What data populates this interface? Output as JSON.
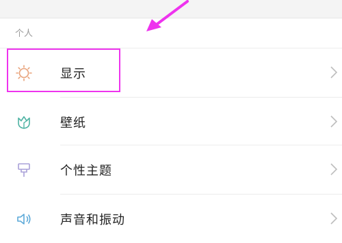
{
  "section": {
    "title": "个人"
  },
  "items": [
    {
      "label": "显示",
      "icon": "sun-icon"
    },
    {
      "label": "壁纸",
      "icon": "tulip-icon"
    },
    {
      "label": "个性主题",
      "icon": "brush-icon"
    },
    {
      "label": "声音和振动",
      "icon": "speaker-icon"
    }
  ],
  "colors": {
    "highlight": "#ee33ee",
    "arrow": "#ee33ee"
  }
}
